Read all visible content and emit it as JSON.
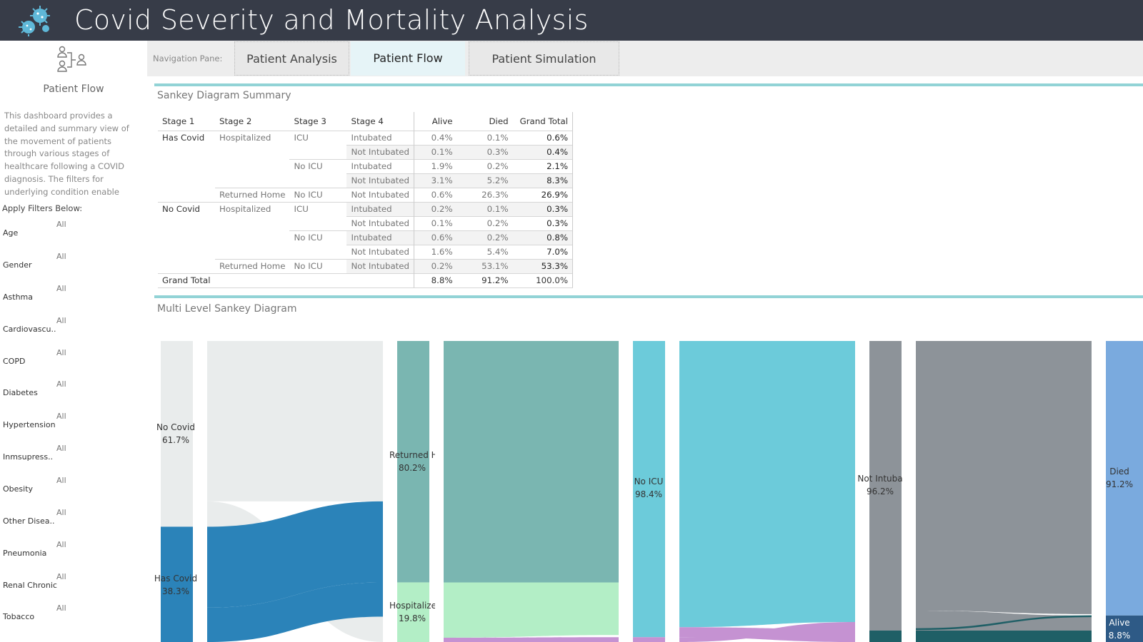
{
  "header": {
    "title": "Covid Severity and Mortality Analysis"
  },
  "sidebar": {
    "title": "Patient Flow",
    "description": "This dashboard provides a detailed and summary view of the movement of patients through various stages of healthcare following a COVID diagnosis. The filters for underlying condition enable analysis of patients at a ..",
    "filters_label": "Apply Filters Below:",
    "filters": [
      {
        "name": "Age",
        "value": "All"
      },
      {
        "name": "Gender",
        "value": "All"
      },
      {
        "name": "Asthma",
        "value": "All"
      },
      {
        "name": "Cardiovascu..",
        "value": "All"
      },
      {
        "name": "COPD",
        "value": "All"
      },
      {
        "name": "Diabetes",
        "value": "All"
      },
      {
        "name": "Hypertension",
        "value": "All"
      },
      {
        "name": "Inmsupress..",
        "value": "All"
      },
      {
        "name": "Obesity",
        "value": "All"
      },
      {
        "name": "Other Disea..",
        "value": "All"
      },
      {
        "name": "Pneumonia",
        "value": "All"
      },
      {
        "name": "Renal Chronic",
        "value": "All"
      },
      {
        "name": "Tobacco",
        "value": "All"
      }
    ]
  },
  "nav": {
    "label": "Navigation Pane:",
    "tabs": [
      {
        "label": "Patient Analysis"
      },
      {
        "label": "Patient Flow"
      },
      {
        "label": "Patient Simulation"
      }
    ]
  },
  "summary": {
    "title": "Sankey Diagram Summary",
    "headers": [
      "Stage 1",
      "Stage 2",
      "Stage 3",
      "Stage 4",
      "Alive",
      "Died",
      "Grand Total"
    ],
    "rows": [
      [
        "Has Covid",
        "Hospitalized",
        "ICU",
        "Intubated",
        "0.4%",
        "0.1%",
        "0.6%"
      ],
      [
        "",
        "",
        "",
        "Not Intubated",
        "0.1%",
        "0.3%",
        "0.4%"
      ],
      [
        "",
        "",
        "No ICU",
        "Intubated",
        "1.9%",
        "0.2%",
        "2.1%"
      ],
      [
        "",
        "",
        "",
        "Not Intubated",
        "3.1%",
        "5.2%",
        "8.3%"
      ],
      [
        "",
        "Returned Home",
        "No ICU",
        "Not Intubated",
        "0.6%",
        "26.3%",
        "26.9%"
      ],
      [
        "No Covid",
        "Hospitalized",
        "ICU",
        "Intubated",
        "0.2%",
        "0.1%",
        "0.3%"
      ],
      [
        "",
        "",
        "",
        "Not Intubated",
        "0.1%",
        "0.2%",
        "0.3%"
      ],
      [
        "",
        "",
        "No ICU",
        "Intubated",
        "0.6%",
        "0.2%",
        "0.8%"
      ],
      [
        "",
        "",
        "",
        "Not Intubated",
        "1.6%",
        "5.4%",
        "7.0%"
      ],
      [
        "",
        "Returned Home",
        "No ICU",
        "Not Intubated",
        "0.2%",
        "53.1%",
        "53.3%"
      ]
    ],
    "grand_total": [
      "Grand Total",
      "8.8%",
      "91.2%",
      "100.0%"
    ]
  },
  "sankey": {
    "title": "Multi Level Sankey Diagram",
    "labels": {
      "no_covid": "No Covid",
      "no_covid_pct": "61.7%",
      "has_covid": "Has Covid",
      "has_covid_pct": "38.3%",
      "returned_home": "Returned H",
      "returned_home_pct": "80.2%",
      "hospitalized": "Hospitalize",
      "hospitalized_pct": "19.8%",
      "no_icu": "No ICU",
      "no_icu_pct": "98.4%",
      "not_intubated": "Not Intuba",
      "not_intubated_pct": "96.2%",
      "died": "Died",
      "died_pct": "91.2%",
      "alive": "Alive",
      "alive_pct": "8.8%"
    },
    "colors": {
      "no_covid": "#e9ecec",
      "has_covid": "#2b83b9",
      "returned_home": "#7ab6b1",
      "hospitalized": "#b3eec6",
      "no_icu": "#6ccbda",
      "icu": "#c592d2",
      "not_intubated": "#8d9399",
      "intubated": "#1f5f66",
      "died": "#7aaade",
      "alive": "#2e5a86"
    }
  }
}
